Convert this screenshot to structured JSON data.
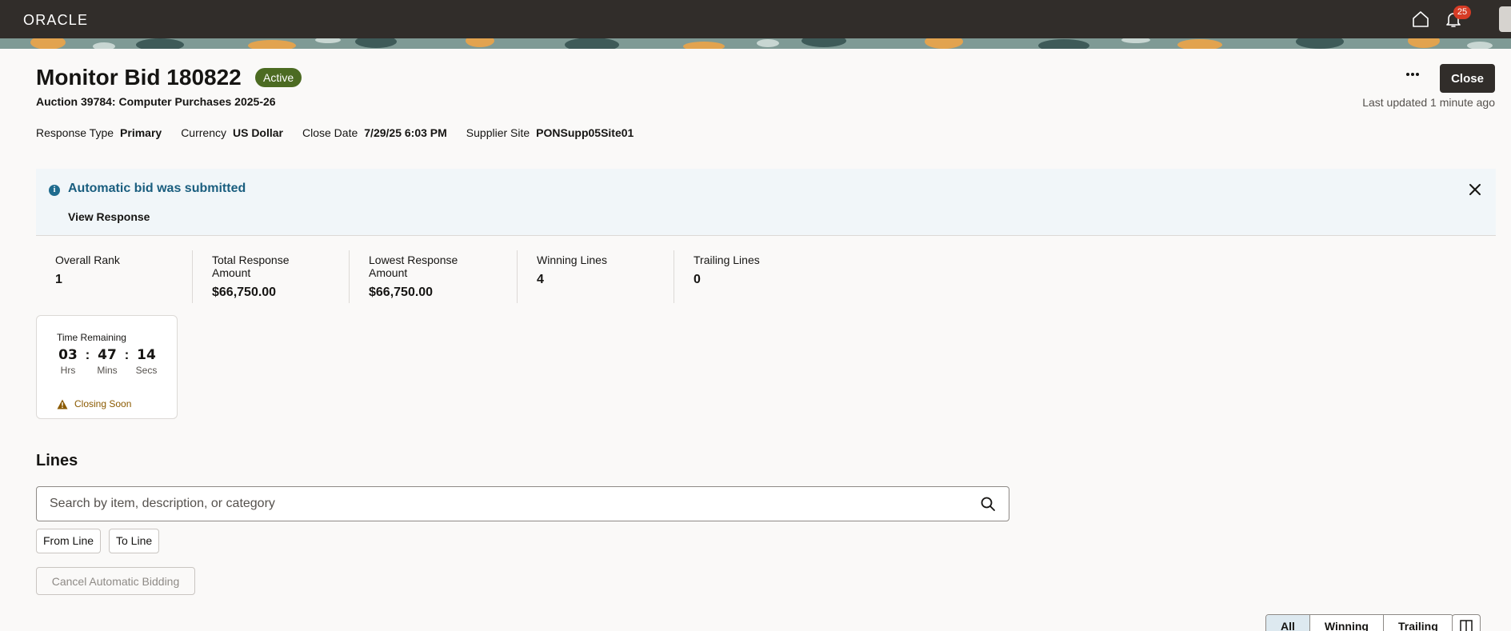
{
  "brand": {
    "logo_text": "ORACLE"
  },
  "header": {
    "notification_count": "25"
  },
  "page": {
    "title": "Monitor Bid 180822",
    "status": "Active",
    "subtitle": "Auction 39784: Computer Purchases 2025-26",
    "close_label": "Close",
    "last_updated": "Last updated 1 minute ago"
  },
  "meta": [
    {
      "label": "Response Type",
      "value": "Primary"
    },
    {
      "label": "Currency",
      "value": "US Dollar"
    },
    {
      "label": "Close Date",
      "value": "7/29/25 6:03 PM"
    },
    {
      "label": "Supplier Site",
      "value": "PONSupp05Site01"
    }
  ],
  "alert": {
    "title": "Automatic bid was submitted",
    "link": "View Response"
  },
  "metrics": [
    {
      "label": "Overall Rank",
      "value": "1"
    },
    {
      "label": "Total Response Amount",
      "value": "$66,750.00"
    },
    {
      "label": "Lowest Response Amount",
      "value": "$66,750.00"
    },
    {
      "label": "Winning Lines",
      "value": "4"
    },
    {
      "label": "Trailing Lines",
      "value": "0"
    }
  ],
  "timer": {
    "label": "Time Remaining",
    "hours": "03",
    "hours_unit": "Hrs",
    "minutes": "47",
    "minutes_unit": "Mins",
    "seconds": "14",
    "seconds_unit": "Secs",
    "warning": "Closing Soon"
  },
  "lines": {
    "heading": "Lines",
    "search_placeholder": "Search by item, description, or category",
    "from_line": "From Line",
    "to_line": "To Line",
    "cancel_label": "Cancel Automatic Bidding",
    "filters": [
      "All",
      "Winning",
      "Trailing"
    ],
    "active_filter": "All"
  },
  "colors": {
    "topbar": "#312d2a",
    "status_active": "#4c6b22",
    "alert_title": "#1a5e7f",
    "warning": "#8b5a00",
    "badge": "#d63b25"
  }
}
